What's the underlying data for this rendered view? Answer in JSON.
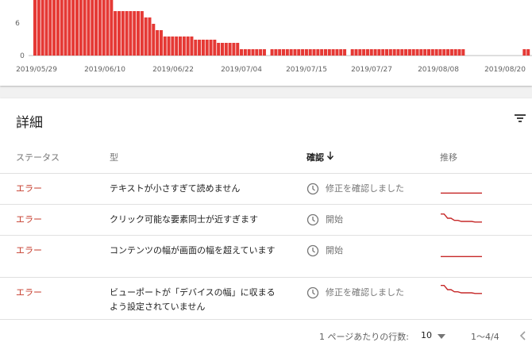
{
  "chart_data": {
    "type": "bar",
    "x_ticks": [
      "2019/05/29",
      "2019/06/10",
      "2019/06/22",
      "2019/07/04",
      "2019/07/15",
      "2019/07/27",
      "2019/08/08",
      "2019/08/20"
    ],
    "y_ticks": [
      "6",
      "0"
    ],
    "ylim": [
      0,
      10
    ],
    "values": [
      10,
      10,
      10,
      10,
      10,
      10,
      10,
      10,
      10,
      10,
      10,
      10,
      10,
      10,
      10,
      10,
      10,
      10,
      10,
      10,
      10,
      7,
      7,
      7,
      7,
      7,
      7,
      7,
      7,
      6,
      6,
      5,
      4,
      4,
      3,
      3,
      3,
      3,
      3,
      3,
      3,
      3,
      2.5,
      2.5,
      2.5,
      2.5,
      2.5,
      2.5,
      2,
      2,
      2,
      2,
      2,
      2,
      1,
      1,
      1,
      1,
      1,
      1,
      1,
      0,
      1,
      1,
      1,
      1,
      1,
      1,
      1,
      1,
      1,
      1,
      1,
      1,
      1,
      1,
      1,
      1,
      1,
      1,
      1,
      1,
      0,
      1,
      1,
      1,
      1,
      1,
      1,
      1,
      1,
      1,
      1,
      1,
      1,
      1,
      1,
      1,
      1,
      1,
      1,
      1,
      1,
      1,
      1,
      1,
      1,
      1,
      1,
      1,
      1,
      1,
      1,
      0,
      0,
      0,
      0,
      0,
      0,
      0,
      0,
      0,
      0,
      0,
      0,
      0,
      0,
      0,
      1,
      1
    ],
    "color": "#e53935"
  },
  "details": {
    "title": "詳細",
    "filter_icon": "filter-icon",
    "headers": {
      "status": "ステータス",
      "type": "型",
      "confirm": "確認",
      "trend": "推移"
    },
    "rows": [
      {
        "status": "エラー",
        "type": "テキストが小さすぎて読めません",
        "confirm": "修正を確認しました",
        "trend": [
          1,
          1,
          1,
          1,
          1,
          1,
          1,
          1,
          1,
          1,
          1,
          1,
          1
        ]
      },
      {
        "status": "エラー",
        "type": "クリック可能な要素同士が近すぎます",
        "confirm": "開始",
        "trend": [
          5,
          5,
          3,
          3,
          2,
          2,
          1.5,
          1.5,
          1.5,
          1.5,
          1.2,
          1.2,
          1.2
        ]
      },
      {
        "status": "エラー",
        "type": "コンテンツの幅が画面の幅を超えています",
        "confirm": "開始",
        "trend": [
          1,
          1,
          1,
          1,
          1,
          1,
          1,
          1,
          1,
          1,
          1,
          1,
          1
        ]
      },
      {
        "status": "エラー",
        "type": "ビューポートが「デバイスの幅」に収まるよう設定されていません",
        "confirm": "修正を確認しました",
        "trend": [
          5,
          5,
          3,
          3,
          2,
          2,
          1.5,
          1.5,
          1.5,
          1.5,
          1.2,
          1.2,
          1.2
        ]
      }
    ],
    "footer": {
      "rows_per_page_label": "1 ページあたりの行数:",
      "rows_per_page_value": "10",
      "range": "1〜4/4"
    },
    "status_color": "#c53929",
    "spark_color": "#c62828"
  }
}
